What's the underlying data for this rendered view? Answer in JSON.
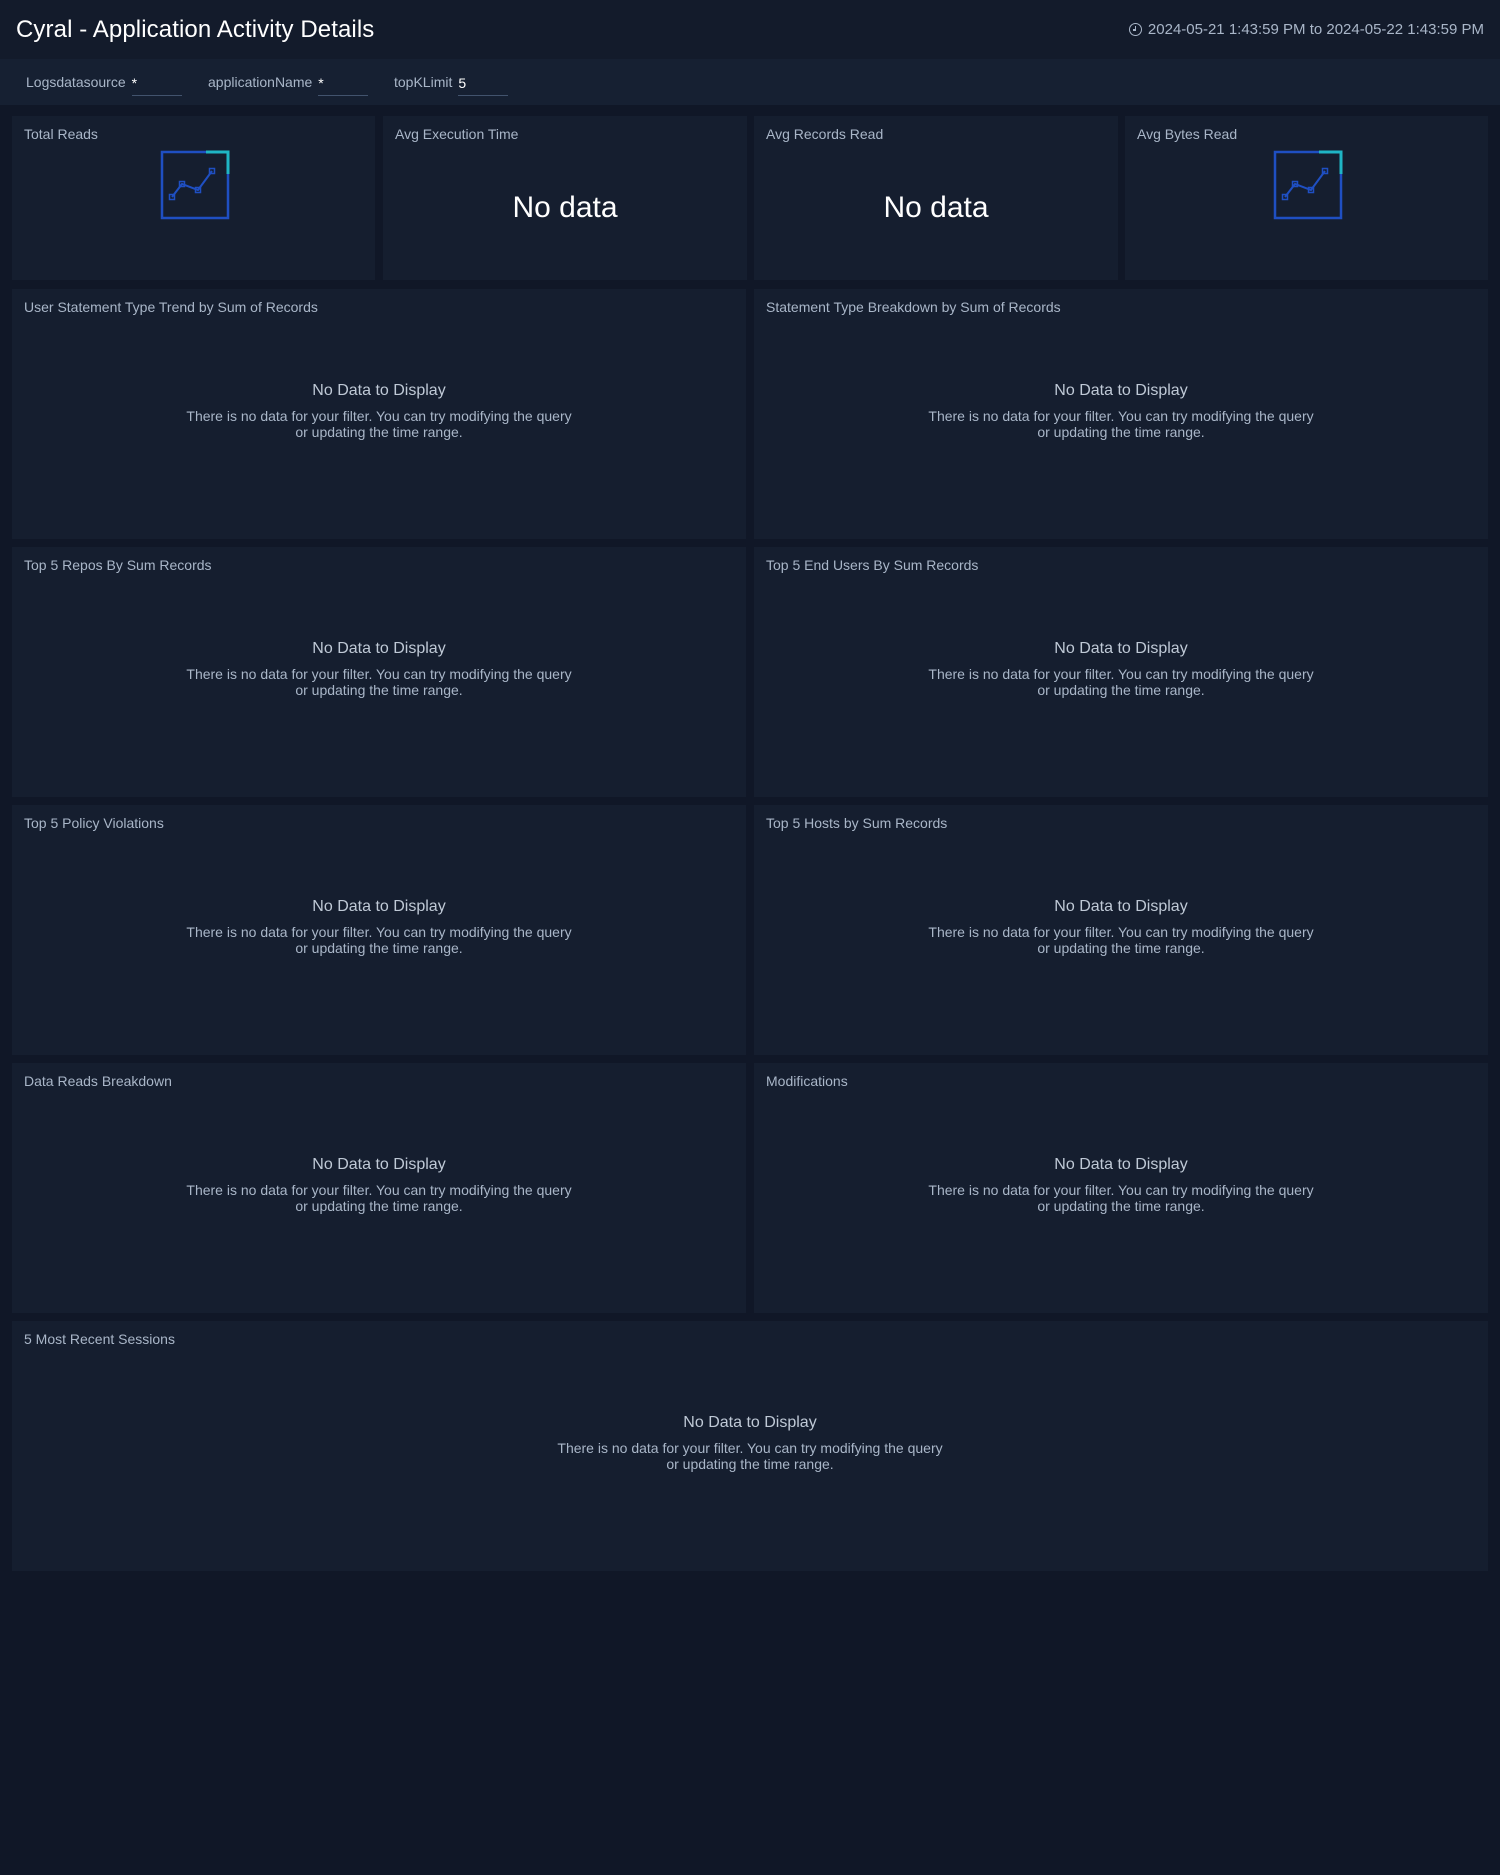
{
  "header": {
    "title": "Cyral - Application Activity Details",
    "time_range": "2024-05-21 1:43:59 PM to 2024-05-22 1:43:59 PM"
  },
  "filters": [
    {
      "label": "Logsdatasource",
      "value": "*"
    },
    {
      "label": "applicationName",
      "value": "*"
    },
    {
      "label": "topKLimit",
      "value": "5"
    }
  ],
  "stat_panels": [
    {
      "title": "Total Reads",
      "state": "chart-placeholder-icon"
    },
    {
      "title": "Avg Execution Time",
      "value": "No data"
    },
    {
      "title": "Avg Records Read",
      "value": "No data"
    },
    {
      "title": "Avg Bytes Read",
      "state": "chart-placeholder-icon"
    }
  ],
  "empty_state": {
    "heading": "No Data to Display",
    "message": "There is no data for your filter. You can try modifying the query or updating the time range."
  },
  "panels": [
    "User Statement Type Trend by Sum of Records",
    "Statement Type Breakdown by Sum of Records",
    "Top 5 Repos By Sum Records",
    "Top 5 End Users By Sum Records",
    "Top 5 Policy Violations",
    "Top 5 Hosts by Sum Records",
    "Data Reads Breakdown",
    "Modifications",
    "5 Most Recent Sessions"
  ],
  "colors": {
    "background": "#101727",
    "panel": "#151e2f",
    "icon_blue": "#1f4fc2",
    "icon_teal": "#1fb5c5"
  }
}
